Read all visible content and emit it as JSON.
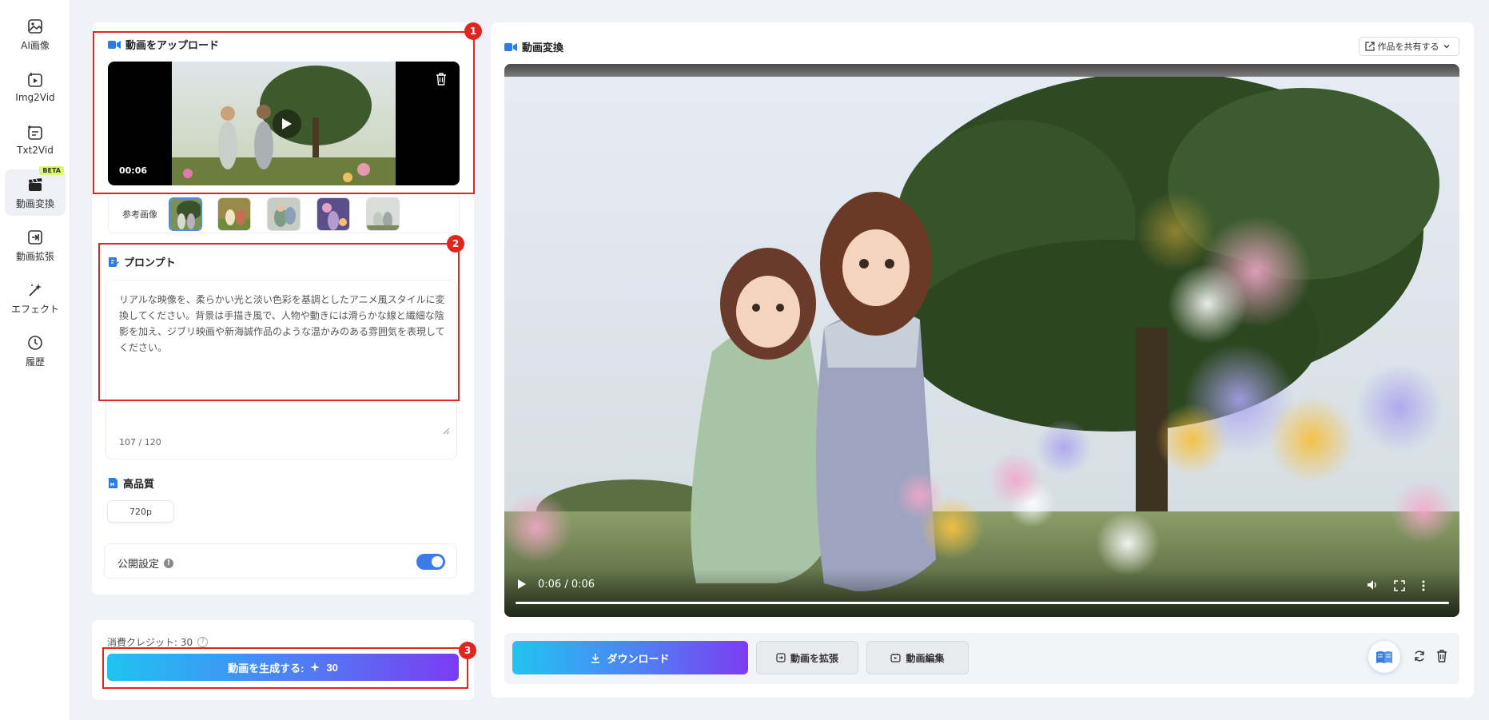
{
  "sidebar": {
    "items": [
      {
        "label": "AI画像",
        "icon": "image-icon"
      },
      {
        "label": "Img2Vid",
        "icon": "img2vid-icon"
      },
      {
        "label": "Txt2Vid",
        "icon": "txt2vid-icon"
      },
      {
        "label": "動画変換",
        "icon": "clapper-icon",
        "badge": "BETA"
      },
      {
        "label": "動画拡張",
        "icon": "expand-icon"
      },
      {
        "label": "エフェクト",
        "icon": "magic-wand-icon"
      },
      {
        "label": "履歴",
        "icon": "clock-icon"
      }
    ]
  },
  "upload": {
    "title": "動画をアップロード",
    "video_time": "00:06"
  },
  "reference": {
    "label": "参考画像",
    "count": 5
  },
  "prompt": {
    "title": "プロンプト",
    "text": "リアルな映像を、柔らかい光と淡い色彩を基調としたアニメ風スタイルに変換してください。背景は手描き風で、人物や動きには滑らかな線と繊細な陰影を加え、ジブリ映画や新海誠作品のような温かみのある雰囲気を表現してください。",
    "char_count": "107 / 120"
  },
  "quality": {
    "title": "高品質",
    "resolution": "720p"
  },
  "public": {
    "label": "公開設定",
    "info": "!",
    "enabled": true
  },
  "generate": {
    "credit_label": "消費クレジット: 30",
    "help": "?",
    "button_label": "動画を生成する:",
    "button_credits": "30"
  },
  "annotations": [
    "1",
    "2",
    "3"
  ],
  "result": {
    "title": "動画変換",
    "share_label": "作品を共有する",
    "player_time": "0:06 / 0:06",
    "download_label": "ダウンロード",
    "extend_label": "動画を拡張",
    "edit_label": "動画編集"
  },
  "colors": {
    "accent_blue": "#3b7be8",
    "gradient_start": "#1fc4f0",
    "gradient_end": "#7a3cf2",
    "annotation_red": "#e0261f"
  }
}
